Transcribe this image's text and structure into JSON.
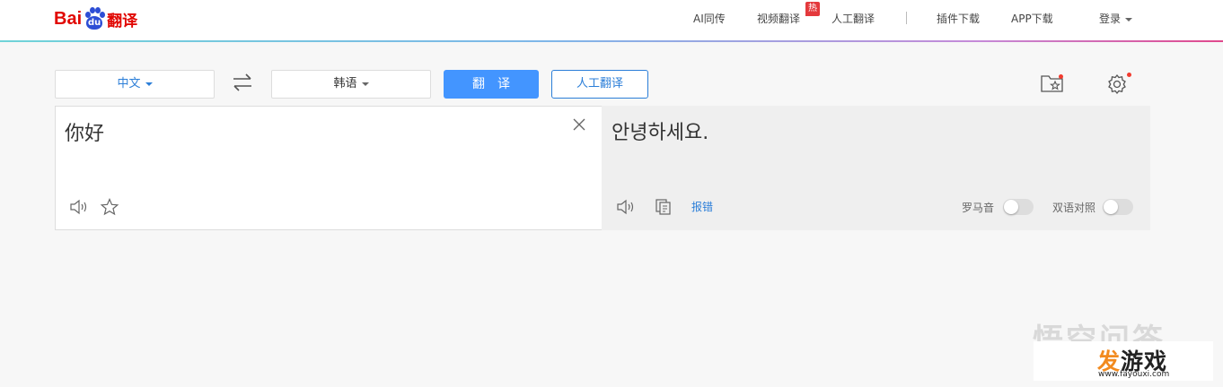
{
  "header": {
    "logo_bai": "Bai",
    "logo_du": "du",
    "logo_fanyi": "翻译",
    "nav": {
      "ai_interpret": "AI同传",
      "video_translate": "视频翻译",
      "hot_badge": "热",
      "human_translate": "人工翻译",
      "plugin_download": "插件下载",
      "app_download": "APP下载",
      "login": "登录"
    }
  },
  "toolbar": {
    "source_lang": "中文",
    "target_lang": "韩语",
    "translate_button": "翻　译",
    "human_translate_button": "人工翻译",
    "icons": [
      "swap-icon",
      "favorites-folder-icon",
      "settings-gear-icon"
    ]
  },
  "source": {
    "text": "你好",
    "icons": [
      "clear-icon",
      "speaker-icon",
      "star-icon"
    ]
  },
  "result": {
    "text": "안녕하세요.",
    "report": "报错",
    "romanization_label": "罗马音",
    "bilingual_label": "双语对照",
    "romanization_on": false,
    "bilingual_on": false,
    "icons": [
      "speaker-icon",
      "copy-icon"
    ]
  },
  "watermark": {
    "logo_fa": "发",
    "logo_rest": "游戏",
    "url": "www.fayouxi.com",
    "faint_text": "悟空问答"
  },
  "colors": {
    "accent": "#4395ff",
    "link": "#2b7ed8",
    "brand_red": "#e10601",
    "badge_red": "#e4393c"
  }
}
